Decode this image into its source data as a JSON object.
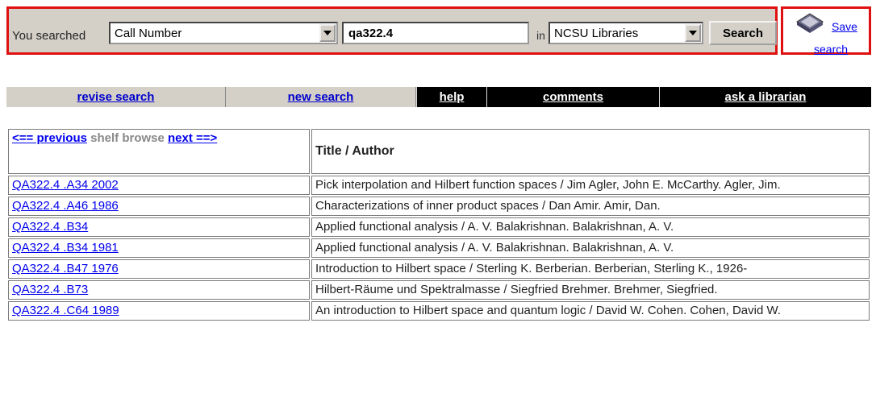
{
  "search": {
    "label": "You searched",
    "field_value": "Call Number",
    "term_value": "qa322.4",
    "in_label": "in",
    "library_value": "NCSU Libraries",
    "button_label": "Search"
  },
  "save": {
    "line1": "Save",
    "line2": "search"
  },
  "nav": {
    "revise": "revise search",
    "new": "new search",
    "help": "help",
    "comments": "comments",
    "ask": "ask a librarian"
  },
  "table": {
    "previous": "<== previous",
    "shelf_browse": "shelf browse",
    "next": "next ==>",
    "title_header": "Title / Author",
    "rows": [
      {
        "call": "QA322.4 .A34 2002",
        "title": "Pick interpolation and Hilbert function spaces / Jim Agler, John E. McCarthy. Agler, Jim."
      },
      {
        "call": "QA322.4 .A46 1986",
        "title": "Characterizations of inner product spaces / Dan Amir. Amir, Dan."
      },
      {
        "call": "QA322.4 .B34",
        "title": "Applied functional analysis / A. V. Balakrishnan. Balakrishnan, A. V."
      },
      {
        "call": "QA322.4 .B34 1981",
        "title": "Applied functional analysis / A. V. Balakrishnan. Balakrishnan, A. V."
      },
      {
        "call": "QA322.4 .B47 1976",
        "title": "Introduction to Hilbert space / Sterling K. Berberian. Berberian, Sterling K., 1926-"
      },
      {
        "call": "QA322.4 .B73",
        "title": "Hilbert-Räume und Spektralmasse / Siegfried Brehmer. Brehmer, Siegfried."
      },
      {
        "call": "QA322.4 .C64 1989",
        "title": "An introduction to Hilbert space and quantum logic / David W. Cohen. Cohen, David W."
      }
    ]
  }
}
